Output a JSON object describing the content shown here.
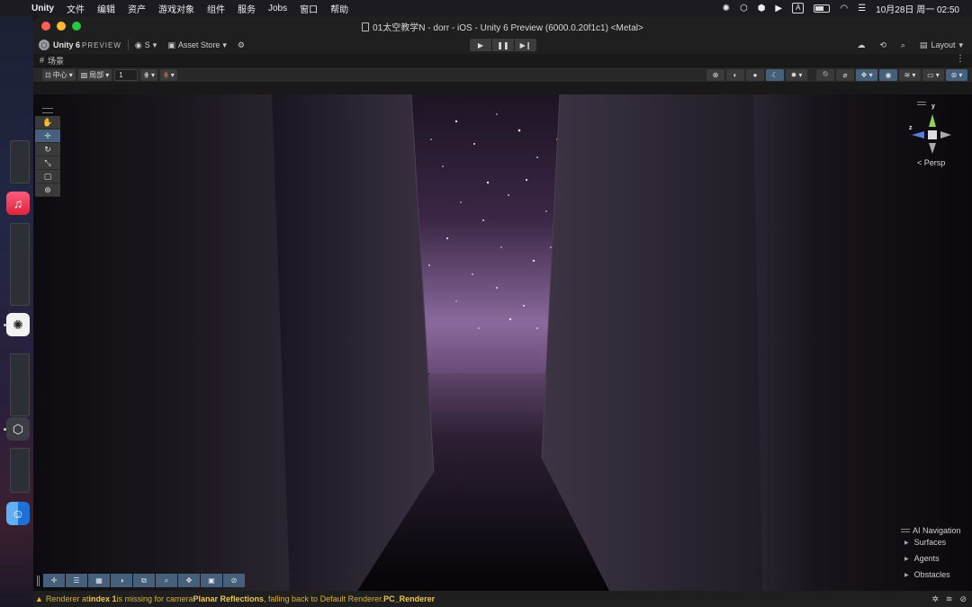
{
  "menubar": {
    "apple_icon": "apple-icon",
    "app_name": "Unity",
    "items": [
      "文件",
      "编辑",
      "资产",
      "游戏对象",
      "组件",
      "服务",
      "Jobs",
      "窗口",
      "帮助"
    ],
    "input_badge": "A",
    "clock": "10月28日 周一  02:50"
  },
  "window": {
    "title": "01太空教学N - dorr - iOS - Unity 6 Preview (6000.0.20f1c1) <Metal>"
  },
  "toolbar": {
    "logo_text": "Unity 6",
    "logo_suffix": "PREVIEW",
    "account_label": "S",
    "asset_store_label": "Asset Store",
    "layout_label": "Layout"
  },
  "scene_tab": {
    "label": "场景"
  },
  "scene_toolbar": {
    "pivot_label": "中心",
    "space_label": "局部",
    "grid_value": "1"
  },
  "gizmo": {
    "z_label": "z",
    "y_label": "y",
    "projection_label": "< Persp"
  },
  "ai_navigation": {
    "title": "AI Navigation",
    "items": [
      "Surfaces",
      "Agents",
      "Obstacles"
    ]
  },
  "status": {
    "prefix": "Renderer at ",
    "index": "index 1",
    "middle": " is missing for camera ",
    "camera": "Planar Reflections",
    "suffix": ", falling back to Default Renderer. ",
    "renderer": "PC_Renderer"
  },
  "colors": {
    "accent_active": "#46607c",
    "warning": "#e8b72f",
    "sky_purple": "#6a4a78"
  }
}
